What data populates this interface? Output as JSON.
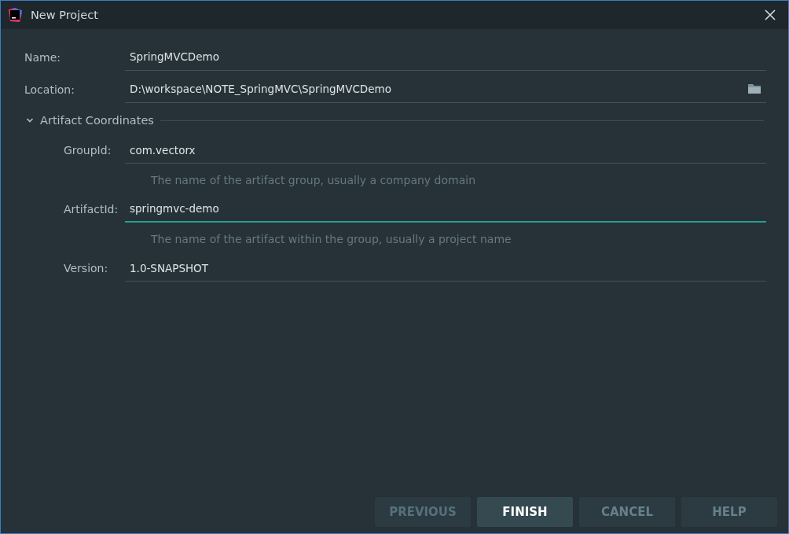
{
  "window": {
    "title": "New Project"
  },
  "fields": [
    {
      "label": "Name:",
      "value": "SpringMVCDemo",
      "focused": false,
      "browse": false
    },
    {
      "label": "Location:",
      "value": "D:\\workspace\\NOTE_SpringMVC\\SpringMVCDemo",
      "focused": false,
      "browse": true
    }
  ],
  "section": {
    "title": "Artifact Coordinates",
    "expanded": true,
    "fields": [
      {
        "label": "GroupId:",
        "value": "com.vectorx",
        "focused": false,
        "hint": "The name of the artifact group, usually a company domain"
      },
      {
        "label": "ArtifactId:",
        "value": "springmvc-demo",
        "focused": true,
        "hint": "The name of the artifact within the group, usually a project name"
      },
      {
        "label": "Version:",
        "value": "1.0-SNAPSHOT",
        "focused": false
      }
    ]
  },
  "buttons": [
    {
      "label": "PREVIOUS",
      "disabled": true,
      "selected": false
    },
    {
      "label": "FINISH",
      "disabled": false,
      "selected": true
    },
    {
      "label": "CANCEL",
      "disabled": false,
      "selected": false
    },
    {
      "label": "HELP",
      "disabled": false,
      "selected": false
    }
  ]
}
